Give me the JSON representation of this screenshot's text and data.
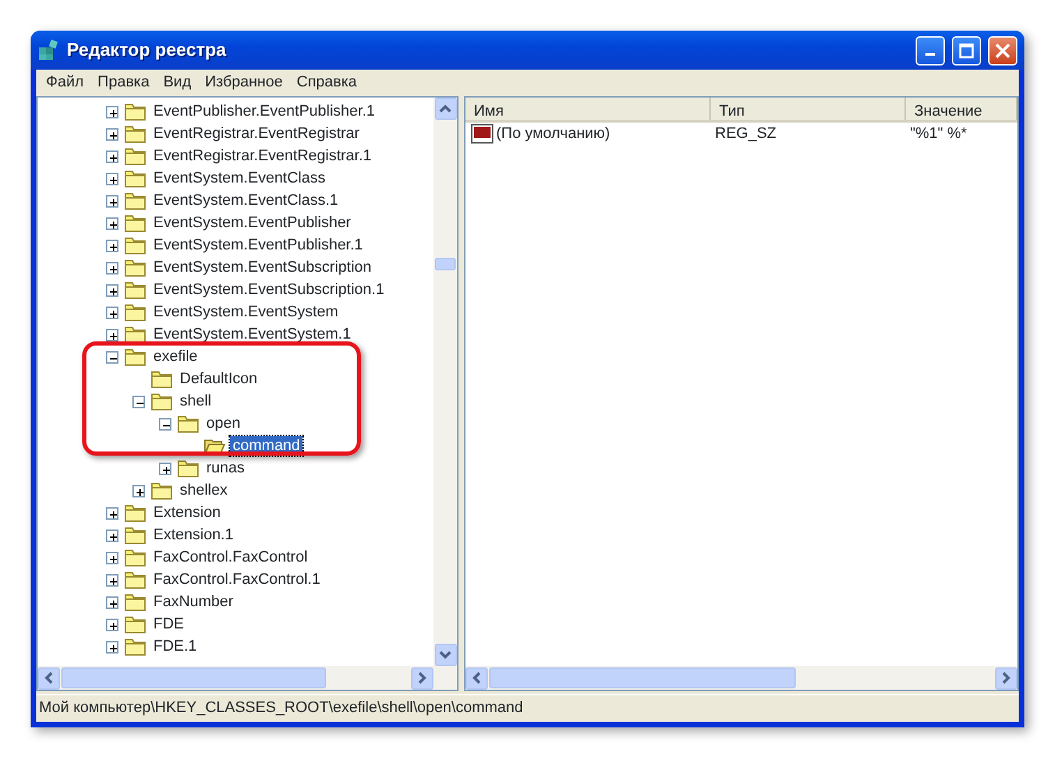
{
  "window": {
    "title": "Редактор реестра"
  },
  "menu": [
    "Файл",
    "Правка",
    "Вид",
    "Избранное",
    "Справка"
  ],
  "tree": [
    {
      "label": "EventPublisher.EventPublisher.1",
      "expanded": false,
      "selected": false
    },
    {
      "label": "EventRegistrar.EventRegistrar",
      "expanded": false,
      "selected": false
    },
    {
      "label": "EventRegistrar.EventRegistrar.1",
      "expanded": false,
      "selected": false
    },
    {
      "label": "EventSystem.EventClass",
      "expanded": false,
      "selected": false
    },
    {
      "label": "EventSystem.EventClass.1",
      "expanded": false,
      "selected": false
    },
    {
      "label": "EventSystem.EventPublisher",
      "expanded": false,
      "selected": false
    },
    {
      "label": "EventSystem.EventPublisher.1",
      "expanded": false,
      "selected": false
    },
    {
      "label": "EventSystem.EventSubscription",
      "expanded": false,
      "selected": false
    },
    {
      "label": "EventSystem.EventSubscription.1",
      "expanded": false,
      "selected": false
    },
    {
      "label": "EventSystem.EventSystem",
      "expanded": false,
      "selected": false
    },
    {
      "label": "EventSystem.EventSystem.1",
      "expanded": false,
      "selected": false
    },
    {
      "label": "exefile",
      "expanded": true,
      "selected": false,
      "children": [
        {
          "label": "DefaultIcon",
          "selected": false
        },
        {
          "label": "shell",
          "expanded": true,
          "selected": false,
          "children": [
            {
              "label": "open",
              "expanded": true,
              "selected": false,
              "children": [
                {
                  "label": "command",
                  "selected": true
                }
              ]
            },
            {
              "label": "runas",
              "expanded": false,
              "selected": false
            }
          ]
        },
        {
          "label": "shellex",
          "expanded": false,
          "selected": false
        }
      ]
    },
    {
      "label": "Extension",
      "expanded": false,
      "selected": false
    },
    {
      "label": "Extension.1",
      "expanded": false,
      "selected": false
    },
    {
      "label": "FaxControl.FaxControl",
      "expanded": false,
      "selected": false
    },
    {
      "label": "FaxControl.FaxControl.1",
      "expanded": false,
      "selected": false
    },
    {
      "label": "FaxNumber",
      "expanded": false,
      "selected": false
    },
    {
      "label": "FDE",
      "expanded": false,
      "selected": false
    },
    {
      "label": "FDE.1",
      "expanded": false,
      "selected": false
    }
  ],
  "values": {
    "columns": [
      "Имя",
      "Тип",
      "Значение"
    ],
    "rows": [
      {
        "name": "(По умолчанию)",
        "type": "REG_SZ",
        "data": "\"%1\" %*"
      }
    ]
  },
  "status_bar": "Мой компьютер\\HKEY_CLASSES_ROOT\\exefile\\shell\\open\\command"
}
